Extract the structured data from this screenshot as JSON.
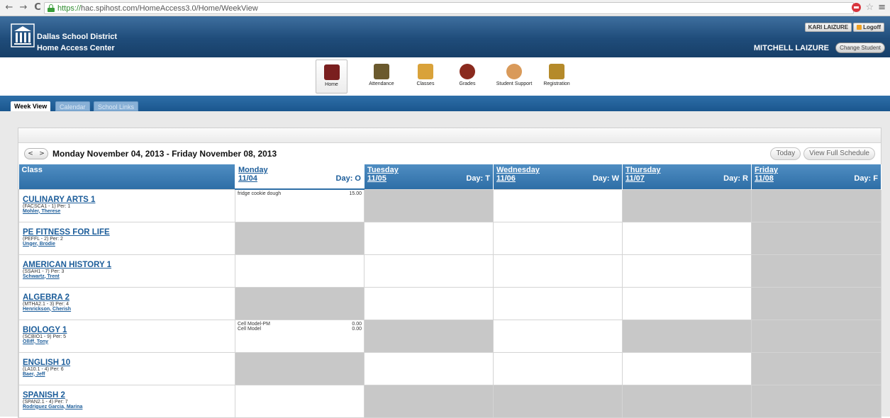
{
  "browser": {
    "back": "←",
    "forward": "→",
    "reload": "C",
    "url_https": "https://",
    "url_rest": "hac.spihost.com/HomeAccess3.0/Home/WeekView"
  },
  "header": {
    "district": "Dallas School District",
    "app_name": "Home Access Center",
    "user": "KARI LAIZURE",
    "logoff": "Logoff",
    "student": "MITCHELL LAIZURE",
    "change_student": "Change Student"
  },
  "modules": [
    {
      "label": "Home",
      "icon": "home-icon",
      "color": "#7a1f1f"
    },
    {
      "label": "Attendance",
      "icon": "attendance-icon",
      "color": "#6b5a2e"
    },
    {
      "label": "Classes",
      "icon": "classes-icon",
      "color": "#d9a23a"
    },
    {
      "label": "Grades",
      "icon": "grades-icon",
      "color": "#8a2a1e"
    },
    {
      "label": "Student Support",
      "icon": "student-support-icon",
      "color": "#d99a5a"
    },
    {
      "label": "Registration",
      "icon": "registration-icon",
      "color": "#b58a2a"
    }
  ],
  "tabs": [
    "Week View",
    "Calendar",
    "School Links"
  ],
  "week": {
    "range": "Monday November 04, 2013 - Friday November 08, 2013",
    "today": "Today",
    "full_schedule": "View Full Schedule",
    "class_header": "Class",
    "days": [
      {
        "name": "Monday",
        "date": "11/04",
        "day": "Day: O"
      },
      {
        "name": "Tuesday",
        "date": "11/05",
        "day": "Day: T"
      },
      {
        "name": "Wednesday",
        "date": "11/06",
        "day": "Day: W"
      },
      {
        "name": "Thursday",
        "date": "11/07",
        "day": "Day: R"
      },
      {
        "name": "Friday",
        "date": "11/08",
        "day": "Day: F"
      }
    ]
  },
  "classes": [
    {
      "name": "CULINARY ARTS 1",
      "code": "(FACSCA1 - 1) Per: 1",
      "teacher": "Mohler, Therese",
      "monday": [
        {
          "title": "fridge cookie dough",
          "score": "15.00"
        }
      ]
    },
    {
      "name": "PE FITNESS FOR LIFE",
      "code": "(PEFFL - 2) Per: 2",
      "teacher": "Unger, Brodie",
      "monday": []
    },
    {
      "name": "AMERICAN HISTORY 1",
      "code": "(SSAH1 - 7) Per: 3",
      "teacher": "Schwartz, Trent",
      "monday": []
    },
    {
      "name": "ALGEBRA 2",
      "code": "(MTHA2.1 - 3) Per: 4",
      "teacher": "Henrickson, Cherish",
      "monday": []
    },
    {
      "name": "BIOLOGY 1",
      "code": "(SCBIO1 - 9) Per: 5",
      "teacher": "Olliff, Tony",
      "monday": [
        {
          "title": "Cell Model-PM",
          "score": "0.00"
        },
        {
          "title": "Cell Model",
          "score": "0.00"
        }
      ]
    },
    {
      "name": "ENGLISH 10",
      "code": "(LA10.1 - 4) Per: 6",
      "teacher": "Baer, Jeff",
      "monday": []
    },
    {
      "name": "SPANISH 2",
      "code": "(SPAN2.1 - 4) Per: 7",
      "teacher": "Rodriguez Garcia, Marina",
      "monday": []
    }
  ]
}
